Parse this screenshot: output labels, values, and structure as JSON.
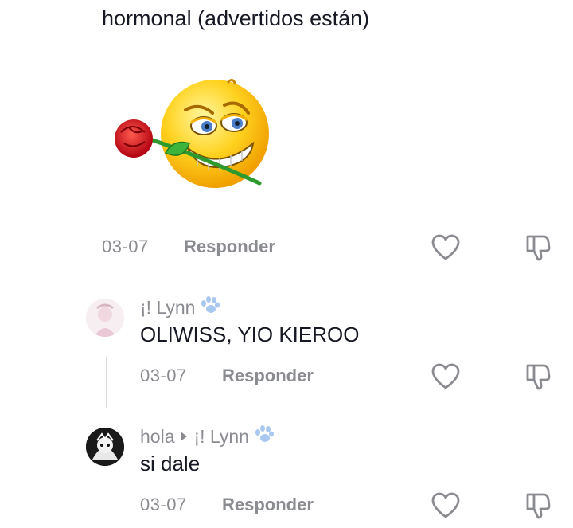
{
  "top_comment": {
    "text": "hormonal (advertidos están)",
    "sticker": "rose-kiss-emoji-sticker",
    "date": "03-07",
    "reply_label": "Responder"
  },
  "replies": [
    {
      "username": "¡! Lynn",
      "username_icon": "paw-icon",
      "text": "OLIWISS, YIO KIEROO",
      "date": "03-07",
      "reply_label": "Responder"
    },
    {
      "username": "hola",
      "reply_to": "¡! Lynn",
      "reply_to_icon": "paw-icon",
      "text": "si dale",
      "date": "03-07",
      "reply_label": "Responder"
    }
  ],
  "colors": {
    "text": "#161823",
    "meta": "#8a8b91",
    "paw": "#a9c8f0"
  }
}
